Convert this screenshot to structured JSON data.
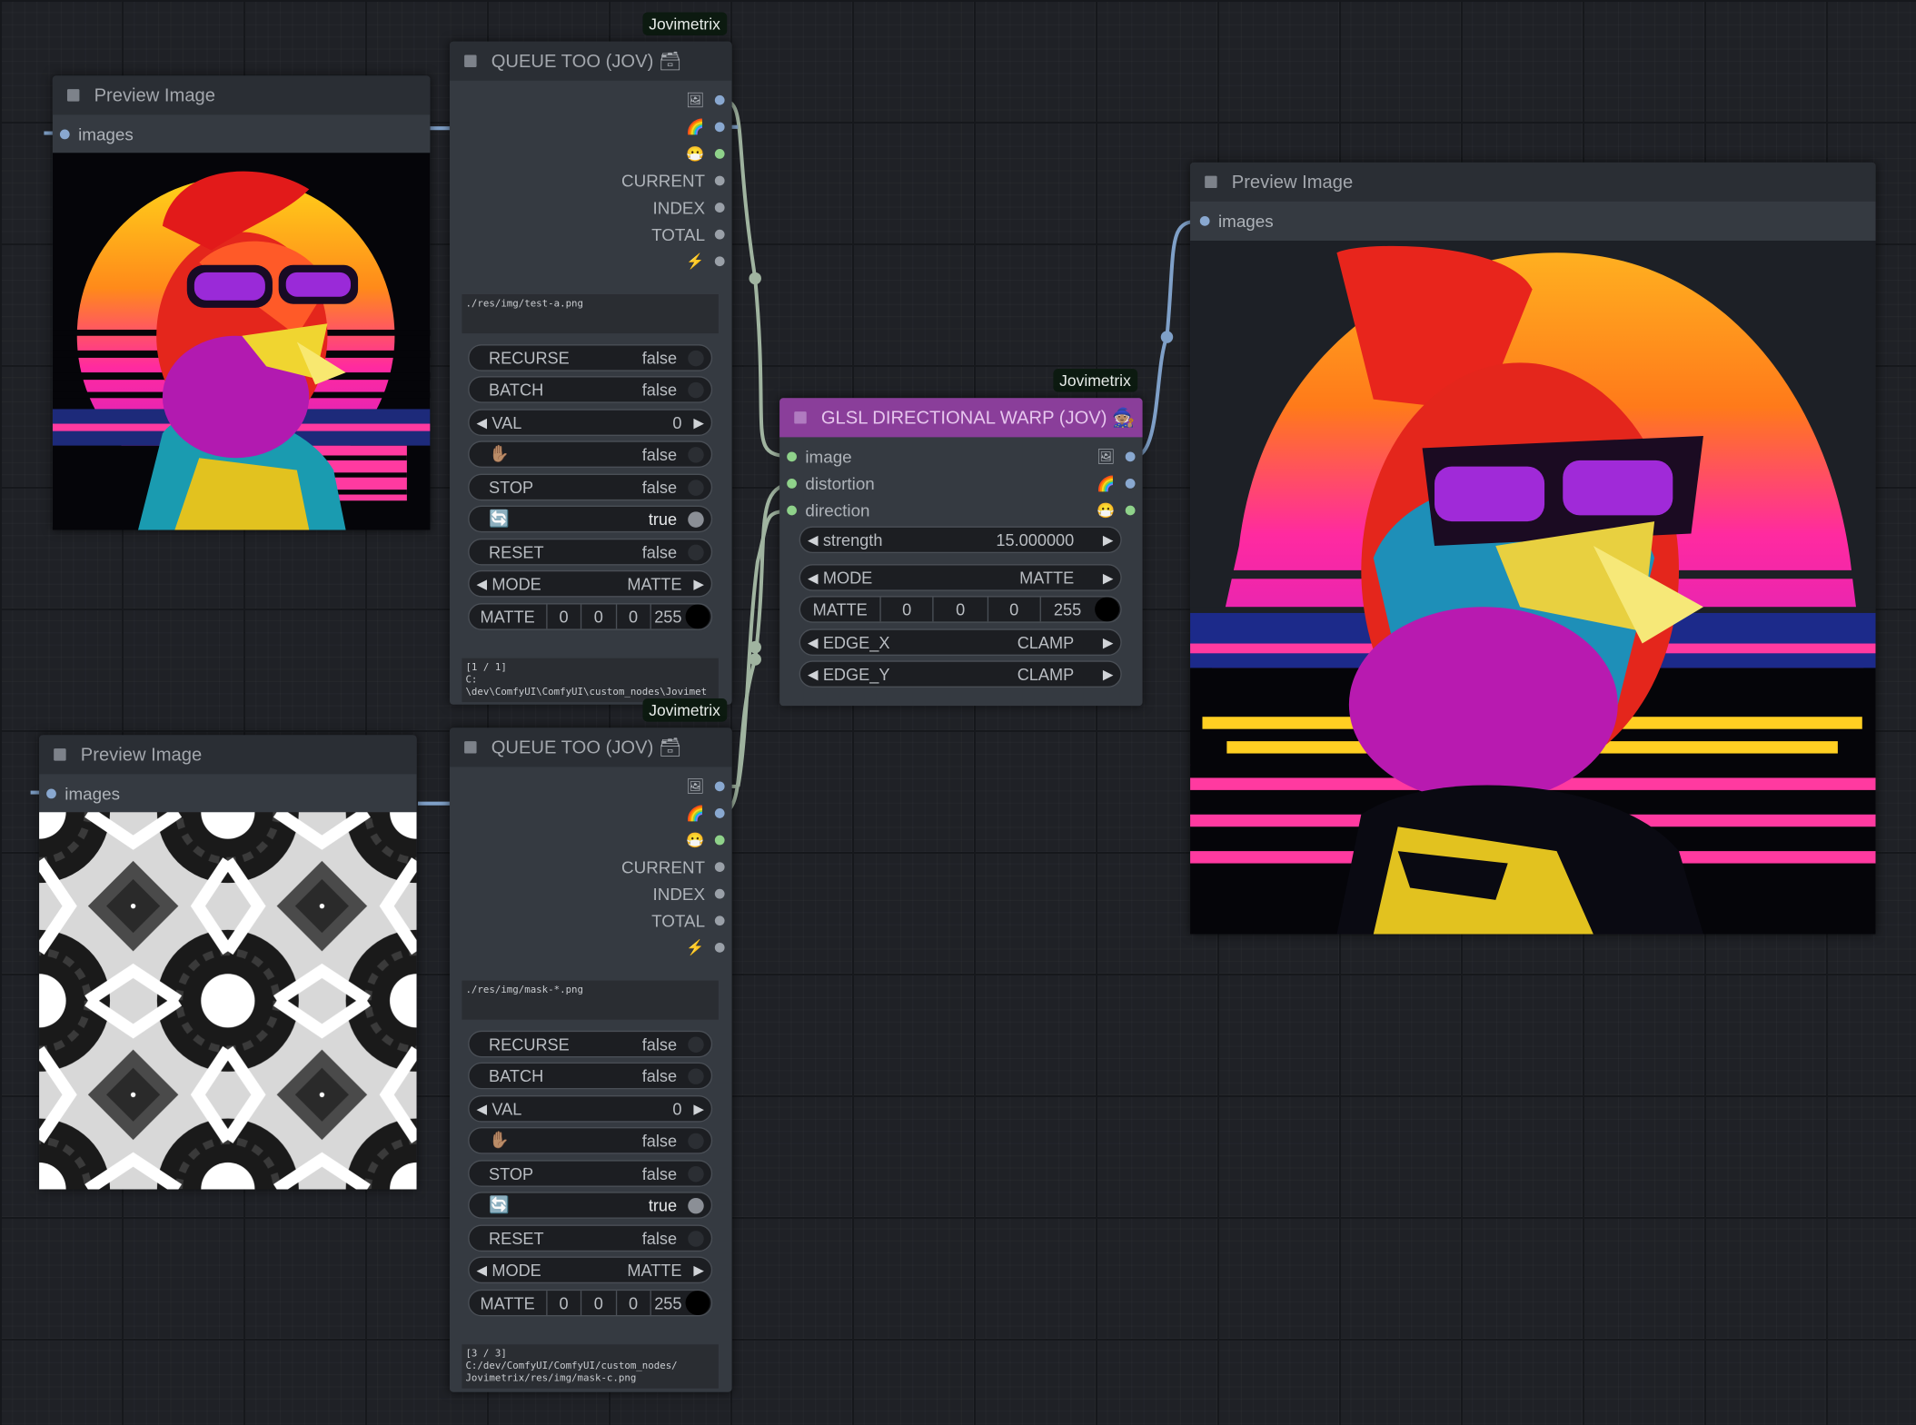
{
  "brand_tag": "Jovimetrix",
  "preview_top": {
    "title": "Preview Image",
    "input": "images"
  },
  "preview_bottom": {
    "title": "Preview Image",
    "input": "images"
  },
  "preview_right": {
    "title": "Preview Image",
    "input": "images"
  },
  "queue_top": {
    "title": "QUEUE TOO (JOV) 🗃",
    "outputs": {
      "current": "CURRENT",
      "index": "INDEX",
      "total": "TOTAL"
    },
    "path": "./res/img/test-a.png",
    "widgets": {
      "recurse": {
        "label": "RECURSE",
        "value": "false"
      },
      "batch": {
        "label": "BATCH",
        "value": "false"
      },
      "val": {
        "label": "VAL",
        "value": "0"
      },
      "hold": {
        "label": "✋🏽",
        "value": "false"
      },
      "stop": {
        "label": "STOP",
        "value": "false"
      },
      "loop": {
        "label": "🔄",
        "value": "true"
      },
      "reset": {
        "label": "RESET",
        "value": "false"
      },
      "mode": {
        "label": "MODE",
        "value": "MATTE"
      },
      "matte": {
        "label": "MATTE",
        "r": "0",
        "g": "0",
        "b": "0",
        "a": "255"
      }
    },
    "status": "[1 / 1]\nC:\n\\dev\\ComfyUI\\ComfyUI\\custom_nodes\\Jovimet"
  },
  "queue_bottom": {
    "title": "QUEUE TOO (JOV) 🗃",
    "outputs": {
      "current": "CURRENT",
      "index": "INDEX",
      "total": "TOTAL"
    },
    "path": "./res/img/mask-*.png",
    "widgets": {
      "recurse": {
        "label": "RECURSE",
        "value": "false"
      },
      "batch": {
        "label": "BATCH",
        "value": "false"
      },
      "val": {
        "label": "VAL",
        "value": "0"
      },
      "hold": {
        "label": "✋🏽",
        "value": "false"
      },
      "stop": {
        "label": "STOP",
        "value": "false"
      },
      "loop": {
        "label": "🔄",
        "value": "true"
      },
      "reset": {
        "label": "RESET",
        "value": "false"
      },
      "mode": {
        "label": "MODE",
        "value": "MATTE"
      },
      "matte": {
        "label": "MATTE",
        "r": "0",
        "g": "0",
        "b": "0",
        "a": "255"
      }
    },
    "status": "[3 / 3]\nC:/dev/ComfyUI/ComfyUI/custom_nodes/\nJovimetrix/res/img/mask-c.png"
  },
  "warp": {
    "title": "GLSL DIRECTIONAL WARP (JOV) 🧙🏽",
    "inputs": {
      "image": "image",
      "distortion": "distortion",
      "direction": "direction"
    },
    "widgets": {
      "strength": {
        "label": "strength",
        "value": "15.000000"
      },
      "mode": {
        "label": "MODE",
        "value": "MATTE"
      },
      "matte": {
        "label": "MATTE",
        "r": "0",
        "g": "0",
        "b": "0",
        "a": "255"
      },
      "edge_x": {
        "label": "EDGE_X",
        "value": "CLAMP"
      },
      "edge_y": {
        "label": "EDGE_Y",
        "value": "CLAMP"
      }
    }
  },
  "colors": {
    "socket_image": "#89a8d0",
    "socket_mask": "#8fd28a",
    "socket_blue": "#7fa0c8",
    "link": "#a0b4a0",
    "warp_header": "#8a3e9a"
  }
}
